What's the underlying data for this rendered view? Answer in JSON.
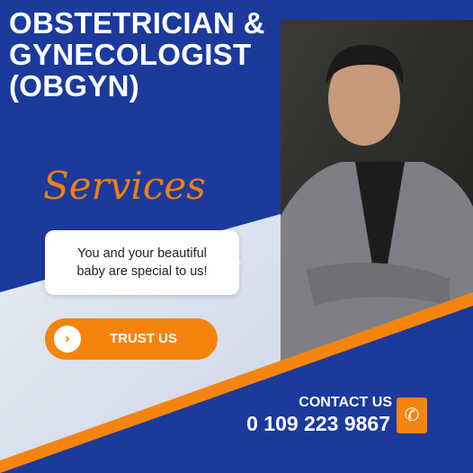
{
  "title": {
    "line1": "OBSTETRICIAN &",
    "line2": "GYNECOLOGIST",
    "line3": "(OBGYN)"
  },
  "services_label": "Services",
  "message": {
    "line1": "You and your beautiful",
    "line2": "baby are special to us!"
  },
  "cta": {
    "label": "TRUST US",
    "icon": "chevron-right-icon"
  },
  "contact": {
    "label": "CONTACT US",
    "phone": "0 109 223 9867",
    "icon": "phone-icon"
  },
  "colors": {
    "blue": "#1b3a9c",
    "orange": "#f5840f",
    "white": "#ffffff"
  }
}
